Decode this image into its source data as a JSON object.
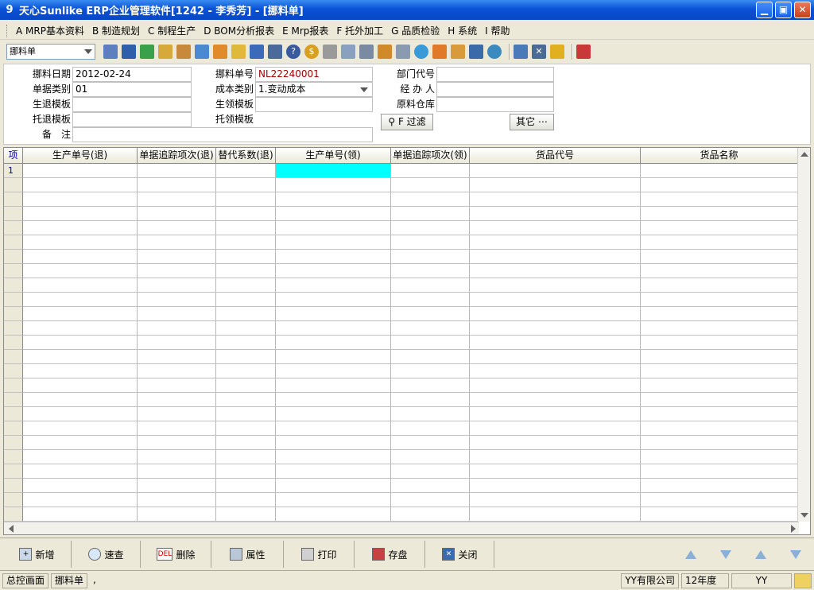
{
  "window": {
    "title": "天心Sunlike ERP企业管理软件[1242 - 李秀芳] - [挪料单]"
  },
  "menu": [
    "A MRP基本资料",
    "B 制造规划",
    "C 制程生产",
    "D BOM分析报表",
    "E Mrp报表",
    "F 托外加工",
    "G 品质检验",
    "H 系统",
    "I 帮助"
  ],
  "toolbar": {
    "form_select": "挪料单"
  },
  "form": {
    "date_label": "挪料日期",
    "date_value": "2012-02-24",
    "doc_type_label": "单据类别",
    "doc_type_value": "01",
    "return_tpl_label": "生退模板",
    "outsrc_return_tpl_label": "托退模板",
    "note_label": "备　注",
    "doc_no_label": "挪料单号",
    "doc_no_value": "NL22240001",
    "cost_type_label": "成本类别",
    "cost_type_value": "1.变动成本",
    "issue_tpl_label": "生领模板",
    "outsrc_issue_tpl_label": "托领模板",
    "dept_label": "部门代号",
    "handler_label": "经 办 人",
    "warehouse_label": "原料仓库",
    "filter_button": "F 过滤",
    "other_button": "其它 ⋯"
  },
  "grid": {
    "columns": [
      "项",
      "生产单号(退)",
      "单据追踪项次(退)",
      "替代系数(退)",
      "生产单号(领)",
      "单据追踪项次(领)",
      "货品代号",
      "货品名称"
    ],
    "first_row_index": "1"
  },
  "actions": {
    "add": "新增",
    "query": "速查",
    "delete": "删除",
    "property": "属性",
    "print": "打印",
    "save": "存盘",
    "close": "关闭"
  },
  "status": {
    "home": "总控画面",
    "current": "挪料单",
    "sep": ",",
    "company": "YY有限公司",
    "year": "12年度",
    "user": "YY"
  }
}
